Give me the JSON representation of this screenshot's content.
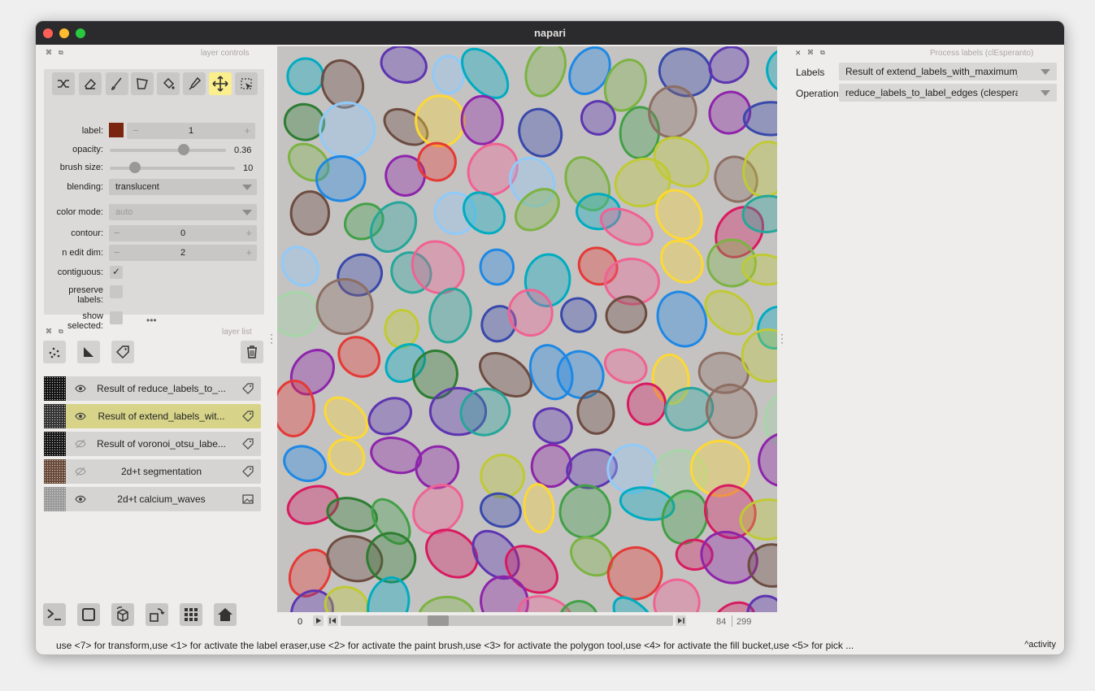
{
  "window": {
    "title": "napari"
  },
  "layer_controls": {
    "header": "layer controls",
    "tools": [
      "shuffle-icon",
      "eraser-icon",
      "paint-brush-icon",
      "polygon-icon",
      "fill-bucket-icon",
      "color-picker-icon",
      "move-icon",
      "transform-icon"
    ],
    "label": {
      "label": "label:",
      "value": "1",
      "color": "#7a2510",
      "minus": "−",
      "plus": "+"
    },
    "opacity": {
      "label": "opacity:",
      "value": "0.36",
      "fraction": 0.36
    },
    "brush_size": {
      "label": "brush size:",
      "value": "10",
      "fraction": 0.2
    },
    "blending": {
      "label": "blending:",
      "value": "translucent"
    },
    "color_mode": {
      "label": "color mode:",
      "value": "auto"
    },
    "contour": {
      "label": "contour:",
      "value": "0",
      "minus": "−",
      "plus": "+"
    },
    "n_edit_dim": {
      "label": "n edit dim:",
      "value": "2",
      "minus": "−",
      "plus": "+"
    },
    "contiguous": {
      "label": "contiguous:",
      "checked": true,
      "check": "✓"
    },
    "preserve_labels": {
      "label1": "preserve",
      "label2": "labels:",
      "checked": false
    },
    "show_selected": {
      "label1": "show",
      "label2": "selected:",
      "checked": false
    }
  },
  "layer_list": {
    "header": "layer list",
    "layers": [
      {
        "name": "Result of reduce_labels_to_...",
        "visible": true,
        "type": "labels",
        "selected": false
      },
      {
        "name": "Result of extend_labels_wit...",
        "visible": true,
        "type": "labels",
        "selected": true
      },
      {
        "name": "Result of voronoi_otsu_labe...",
        "visible": false,
        "type": "labels",
        "selected": false
      },
      {
        "name": "2d+t segmentation",
        "visible": false,
        "type": "labels",
        "selected": false
      },
      {
        "name": "2d+t calcium_waves",
        "visible": true,
        "type": "image",
        "selected": false
      }
    ]
  },
  "bottom_buttons": [
    "console-icon",
    "ndisplay-icon",
    "roll-icon",
    "transpose-icon",
    "grid-icon",
    "home-icon"
  ],
  "dims_slider": {
    "axis": "0",
    "current": "84",
    "max": "299",
    "fraction": 0.28
  },
  "process_panel": {
    "header": "Process labels (clEsperanto)",
    "labels_label": "Labels",
    "labels_value": "Result of extend_labels_with_maximum_radius",
    "operation_label": "Operation",
    "operation_value": "reduce_labels_to_label_edges (clesperanto)"
  },
  "status_bar": {
    "text": "use <7> for transform,use <1> for activate the label eraser,use <2> for activate the paint brush,use <3> for activate the polygon tool,use <4> for activate the fill bucket,use <5> for pick ...",
    "activity": "activity"
  },
  "colors": {
    "titlebar": "#2b2a2c",
    "selected_layer": "#d7d48a",
    "active_tool": "#fbee8c",
    "close": "#ff5f57",
    "minimize": "#febc2e",
    "maximize": "#28c840"
  }
}
